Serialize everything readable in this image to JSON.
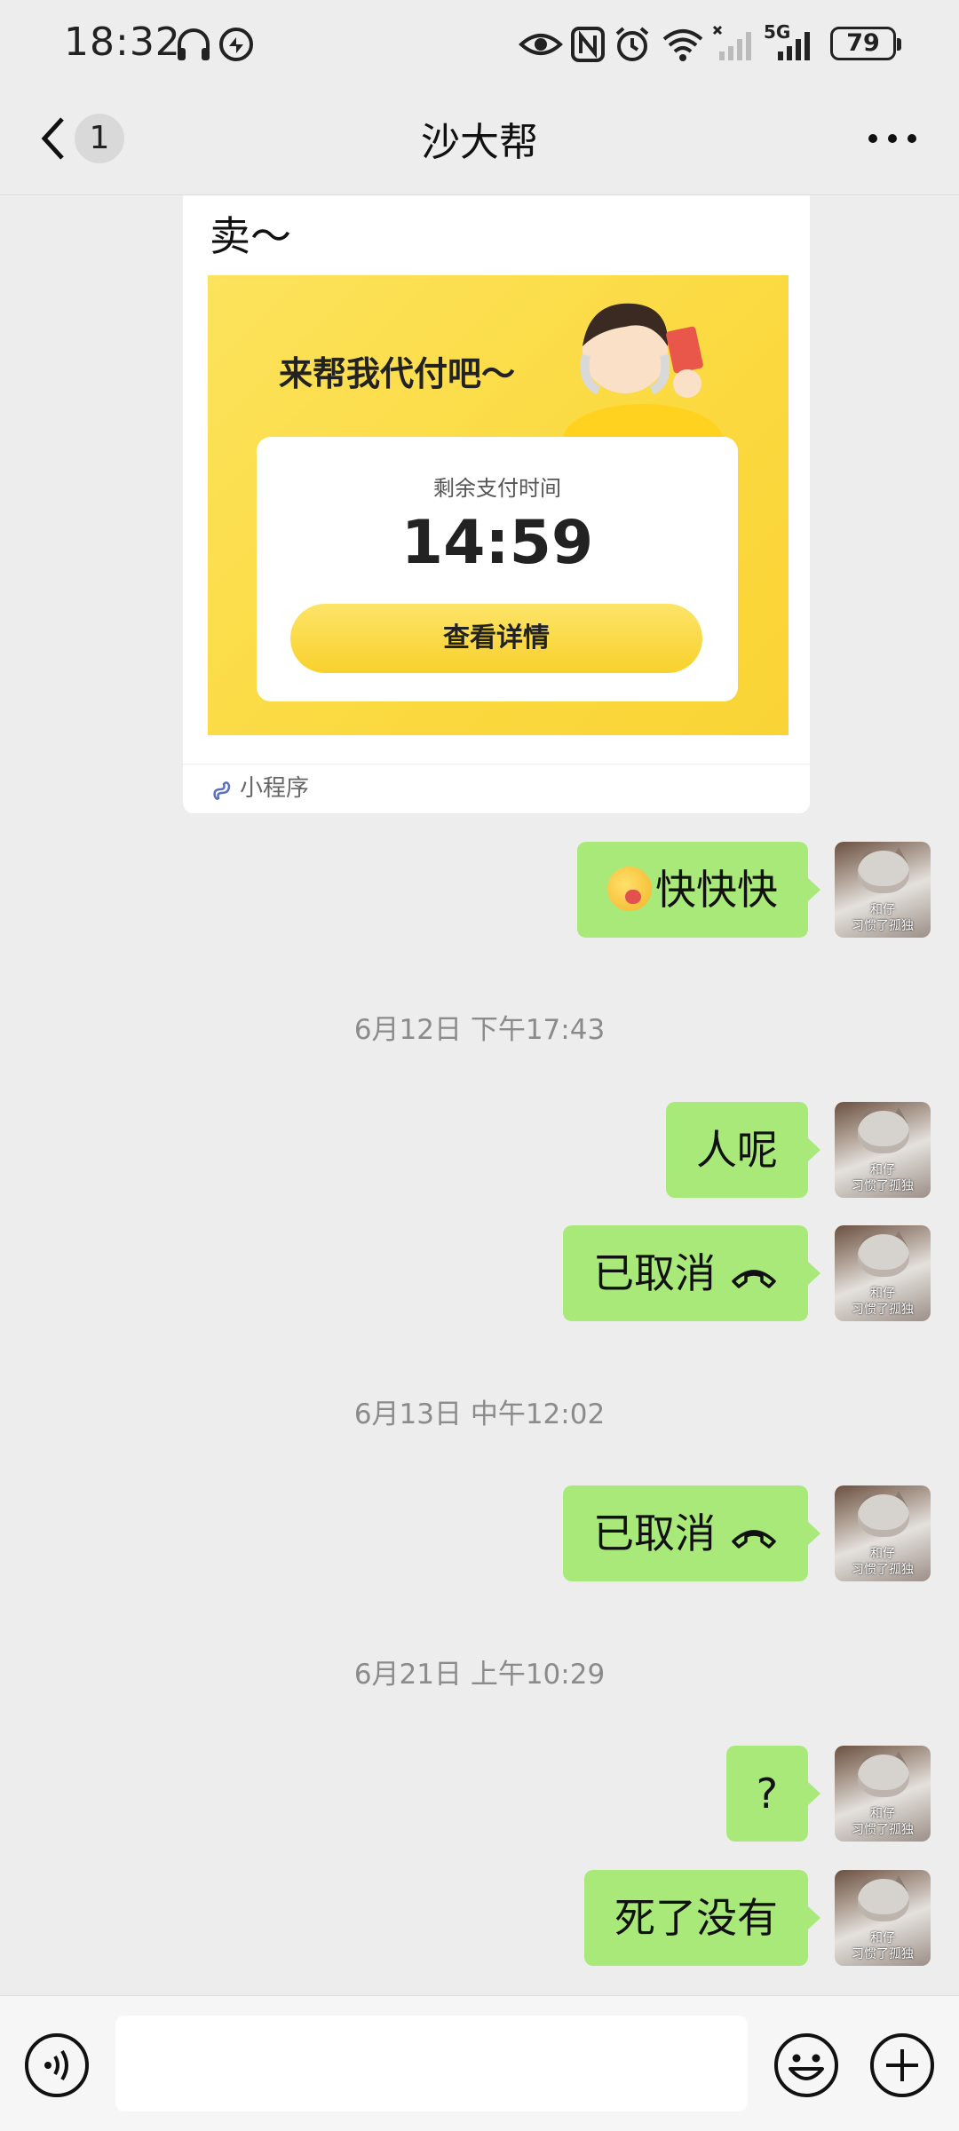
{
  "status_bar": {
    "time": "18:32",
    "network": "5G",
    "battery": "79"
  },
  "header": {
    "back_badge": "1",
    "title": "沙大帮"
  },
  "mini_program_card": {
    "text": "卖～",
    "headline": "来帮我代付吧～",
    "remaining_label": "剩余支付时间",
    "countdown": "14:59",
    "button_label": "查看详情",
    "footer_label": "小程序"
  },
  "messages": [
    {
      "type": "text",
      "emoji": "face-with-tongue-emoji",
      "text": "快快快"
    },
    {
      "type": "time",
      "text": "6月12日 下午17:43"
    },
    {
      "type": "text",
      "text": "人呢"
    },
    {
      "type": "call",
      "text": "已取消"
    },
    {
      "type": "time",
      "text": "6月13日 中午12:02"
    },
    {
      "type": "call",
      "text": "已取消"
    },
    {
      "type": "time",
      "text": "6月21日 上午10:29"
    },
    {
      "type": "text",
      "text": "?"
    },
    {
      "type": "text",
      "text": "死了没有"
    }
  ],
  "avatar": {
    "caption_line1": "和仔",
    "caption_line2": "习惯了孤独"
  },
  "input_bar": {
    "placeholder": ""
  },
  "colors": {
    "bubble_green": "#a9e97a",
    "background": "#ededed",
    "card_yellow": "#fbd93f"
  }
}
